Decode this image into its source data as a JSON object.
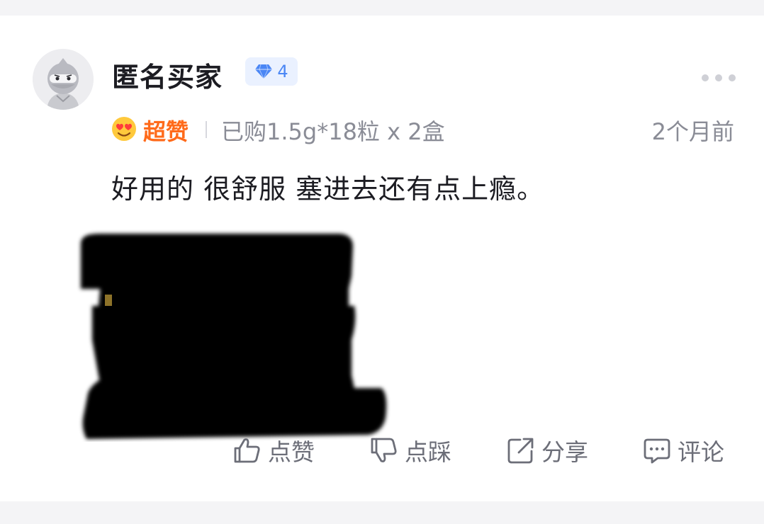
{
  "review": {
    "username": "匿名买家",
    "level": "4",
    "rating_label": "超赞",
    "purchase_info": "已购1.5g*18粒 x 2盒",
    "time_ago": "2个月前",
    "text": "好用的 很舒服 塞进去还有点上瘾。"
  },
  "actions": [
    {
      "label": "点赞",
      "icon": "thumbs-up-icon"
    },
    {
      "label": "点踩",
      "icon": "thumbs-down-icon"
    },
    {
      "label": "分享",
      "icon": "share-icon"
    },
    {
      "label": "评论",
      "icon": "comment-icon"
    }
  ],
  "colors": {
    "accent_rating": "#ff6a1a",
    "badge_bg": "#eaf1ff",
    "badge_fg": "#4a86f5",
    "muted_text": "#8a8c96",
    "action_text": "#6c6e78"
  }
}
